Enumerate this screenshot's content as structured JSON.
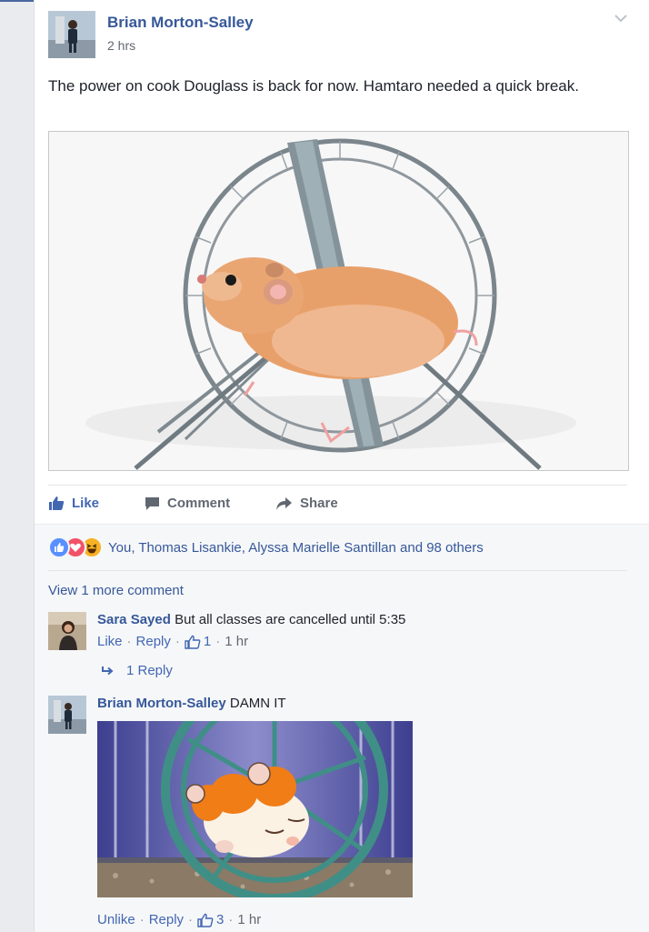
{
  "post": {
    "author": "Brian Morton-Salley",
    "time": "2 hrs",
    "text": "The power on cook Douglass is back for now. Hamtaro needed a quick break.",
    "image_alt": "hamster running in metal wheel"
  },
  "actions": {
    "like": "Like",
    "comment": "Comment",
    "share": "Share"
  },
  "reactions": {
    "icons": [
      "like-reaction",
      "love-reaction",
      "haha-reaction"
    ],
    "names": "You, Thomas Lisankie, Alyssa Marielle Santillan and 98 others"
  },
  "view_more": "View 1 more comment",
  "comments": [
    {
      "author": "Sara Sayed",
      "text": "But all classes are cancelled until 5:35",
      "actions": [
        "Like",
        "Reply"
      ],
      "likes": "1",
      "time": "1 hr",
      "replies_label": "1 Reply"
    },
    {
      "author": "Brian Morton-Salley",
      "text": "DAMN IT",
      "actions": [
        "Unlike",
        "Reply"
      ],
      "likes": "3",
      "time": "1 hr",
      "gif_alt": "Hamtaro sleeping in hamster wheel"
    }
  ],
  "colors": {
    "link": "#365899",
    "accent": "#4267b2",
    "muted": "#616770",
    "like": "#5890ff",
    "love": "#f25268",
    "haha": "#f7b125"
  }
}
